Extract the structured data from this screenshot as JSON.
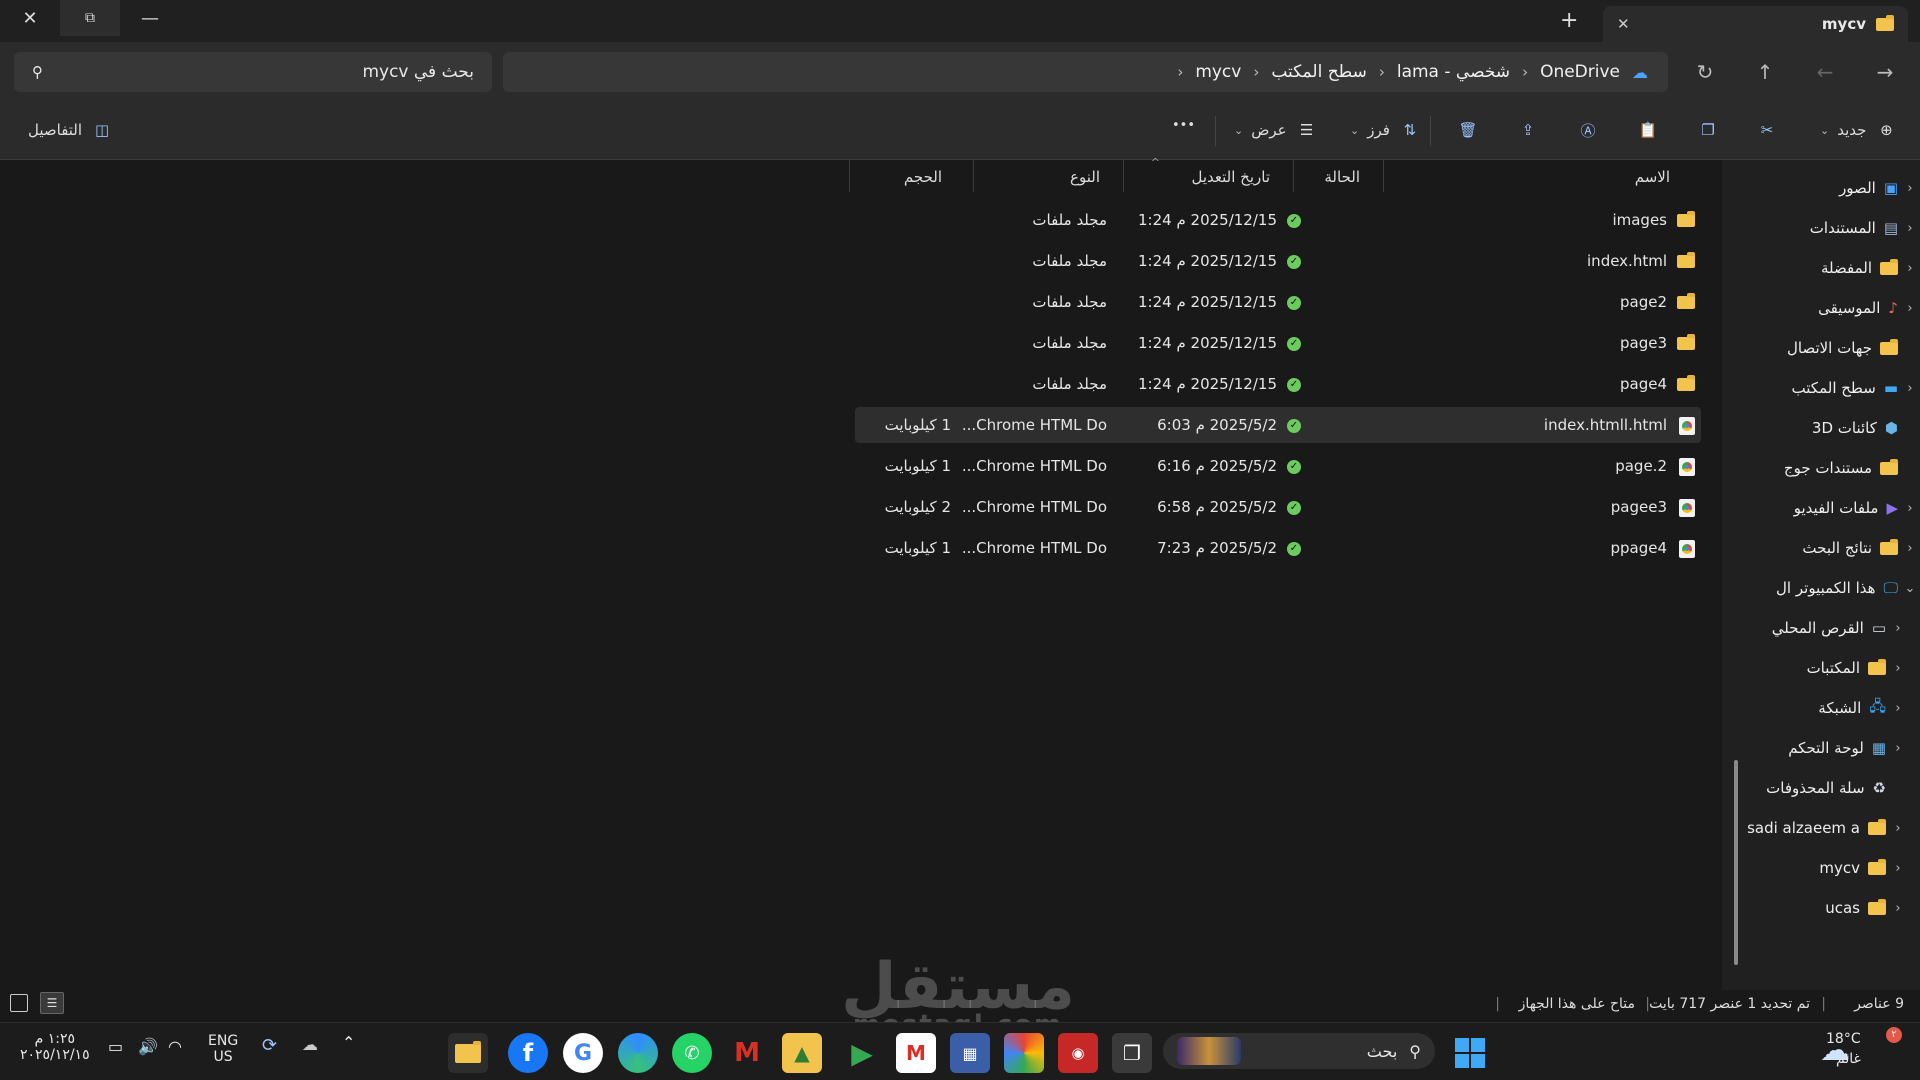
{
  "window": {
    "tab_title": "mycv",
    "new_tab": "+",
    "close_tab": "✕"
  },
  "nav": {
    "breadcrumbs": [
      "OneDrive",
      "شخصي - lama",
      "سطح المكتب",
      "mycv"
    ],
    "search_placeholder": "بحث في mycv"
  },
  "toolbar": {
    "new_label": "جديد",
    "sort_label": "فرز",
    "view_label": "عرض",
    "more_label": "•••",
    "details_label": "التفاصيل"
  },
  "columns": {
    "name": "الاسم",
    "status": "الحالة",
    "modified": "تاريخ التعديل",
    "type": "النوع",
    "size": "الحجم"
  },
  "files": [
    {
      "name": "images",
      "icon": "folder-icon",
      "modified": "2025/12/15 م 1:24",
      "type": "مجلد ملفات",
      "size": ""
    },
    {
      "name": "index.html",
      "icon": "folder-icon",
      "modified": "2025/12/15 م 1:24",
      "type": "مجلد ملفات",
      "size": ""
    },
    {
      "name": "page2",
      "icon": "folder-icon",
      "modified": "2025/12/15 م 1:24",
      "type": "مجلد ملفات",
      "size": ""
    },
    {
      "name": "page3",
      "icon": "folder-icon",
      "modified": "2025/12/15 م 1:24",
      "type": "مجلد ملفات",
      "size": ""
    },
    {
      "name": "page4",
      "icon": "folder-icon",
      "modified": "2025/12/15 م 1:24",
      "type": "مجلد ملفات",
      "size": ""
    },
    {
      "name": "index.htmll.html",
      "icon": "chrome-html-icon",
      "modified": "2025/5/2 م 6:03",
      "type": "Chrome HTML Do...",
      "size": "1 كيلوبايت"
    },
    {
      "name": "page.2",
      "icon": "chrome-html-icon",
      "modified": "2025/5/2 م 6:16",
      "type": "Chrome HTML Do...",
      "size": "1 كيلوبايت"
    },
    {
      "name": "pagee3",
      "icon": "chrome-html-icon",
      "modified": "2025/5/2 م 6:58",
      "type": "Chrome HTML Do...",
      "size": "2 كيلوبايت"
    },
    {
      "name": "ppage4",
      "icon": "chrome-html-icon",
      "modified": "2025/5/2 م 7:23",
      "type": "Chrome HTML Do...",
      "size": "1 كيلوبايت"
    }
  ],
  "sidebar": {
    "items": [
      {
        "label": "الصور",
        "icon": "pictures-icon",
        "color": "#4aa3ff"
      },
      {
        "label": "المستندات",
        "icon": "documents-icon",
        "color": "#9fb4d6"
      },
      {
        "label": "المفضلة",
        "icon": "folder-icon",
        "color": "#f3c44d"
      },
      {
        "label": "الموسيقى",
        "icon": "music-icon",
        "color": "#e0675c"
      },
      {
        "label": "جهات الاتصال",
        "icon": "folder-icon",
        "color": "#f3c44d"
      },
      {
        "label": "سطح المكتب",
        "icon": "desktop-icon",
        "color": "#3fa9f5"
      },
      {
        "label": "كائنات 3D",
        "icon": "3d-objects-icon",
        "color": "#6bb3e6"
      },
      {
        "label": "مستندات جوج",
        "icon": "folder-icon",
        "color": "#f3c44d"
      },
      {
        "label": "ملفات الفيديو",
        "icon": "videos-icon",
        "color": "#8f6ff0"
      },
      {
        "label": "نتائج البحث",
        "icon": "folder-icon",
        "color": "#f3c44d"
      },
      {
        "label": "هذا الكمبيوتر ال",
        "icon": "this-pc-icon",
        "color": "#3fa9f5"
      },
      {
        "label": "القرص المحلي",
        "icon": "drive-icon",
        "color": "#cfd8e3"
      },
      {
        "label": "المكتبات",
        "icon": "folder-icon",
        "color": "#f3c44d"
      },
      {
        "label": "الشبكة",
        "icon": "network-icon",
        "color": "#3fa9f5"
      },
      {
        "label": "لوحة التحكم",
        "icon": "control-panel-icon",
        "color": "#6bb3e6"
      },
      {
        "label": "سلة المحذوفات",
        "icon": "recycle-bin-icon",
        "color": "#cfd8e3"
      },
      {
        "label": "sadi alzaeem a",
        "icon": "folder-icon",
        "color": "#f3c44d"
      },
      {
        "label": "mycv",
        "icon": "folder-icon",
        "color": "#f3c44d"
      },
      {
        "label": "ucas",
        "icon": "folder-icon",
        "color": "#f3c44d"
      }
    ]
  },
  "status": {
    "count": "9 عناصر",
    "selected": "تم تحديد 1 عنصر 717 بايت",
    "availability": "متاح على هذا الجهاز"
  },
  "taskbar": {
    "weather_temp": "18°C",
    "weather_desc": "غائم",
    "search_placeholder": "بحث",
    "lang_top": "ENG",
    "lang_bottom": "US",
    "time": "١:٢٥ م",
    "date": "٢٠٢٥/١٢/١٥",
    "notification_count": "٢"
  },
  "watermark": {
    "main": "مستقل",
    "sub": "mostaql.com"
  }
}
